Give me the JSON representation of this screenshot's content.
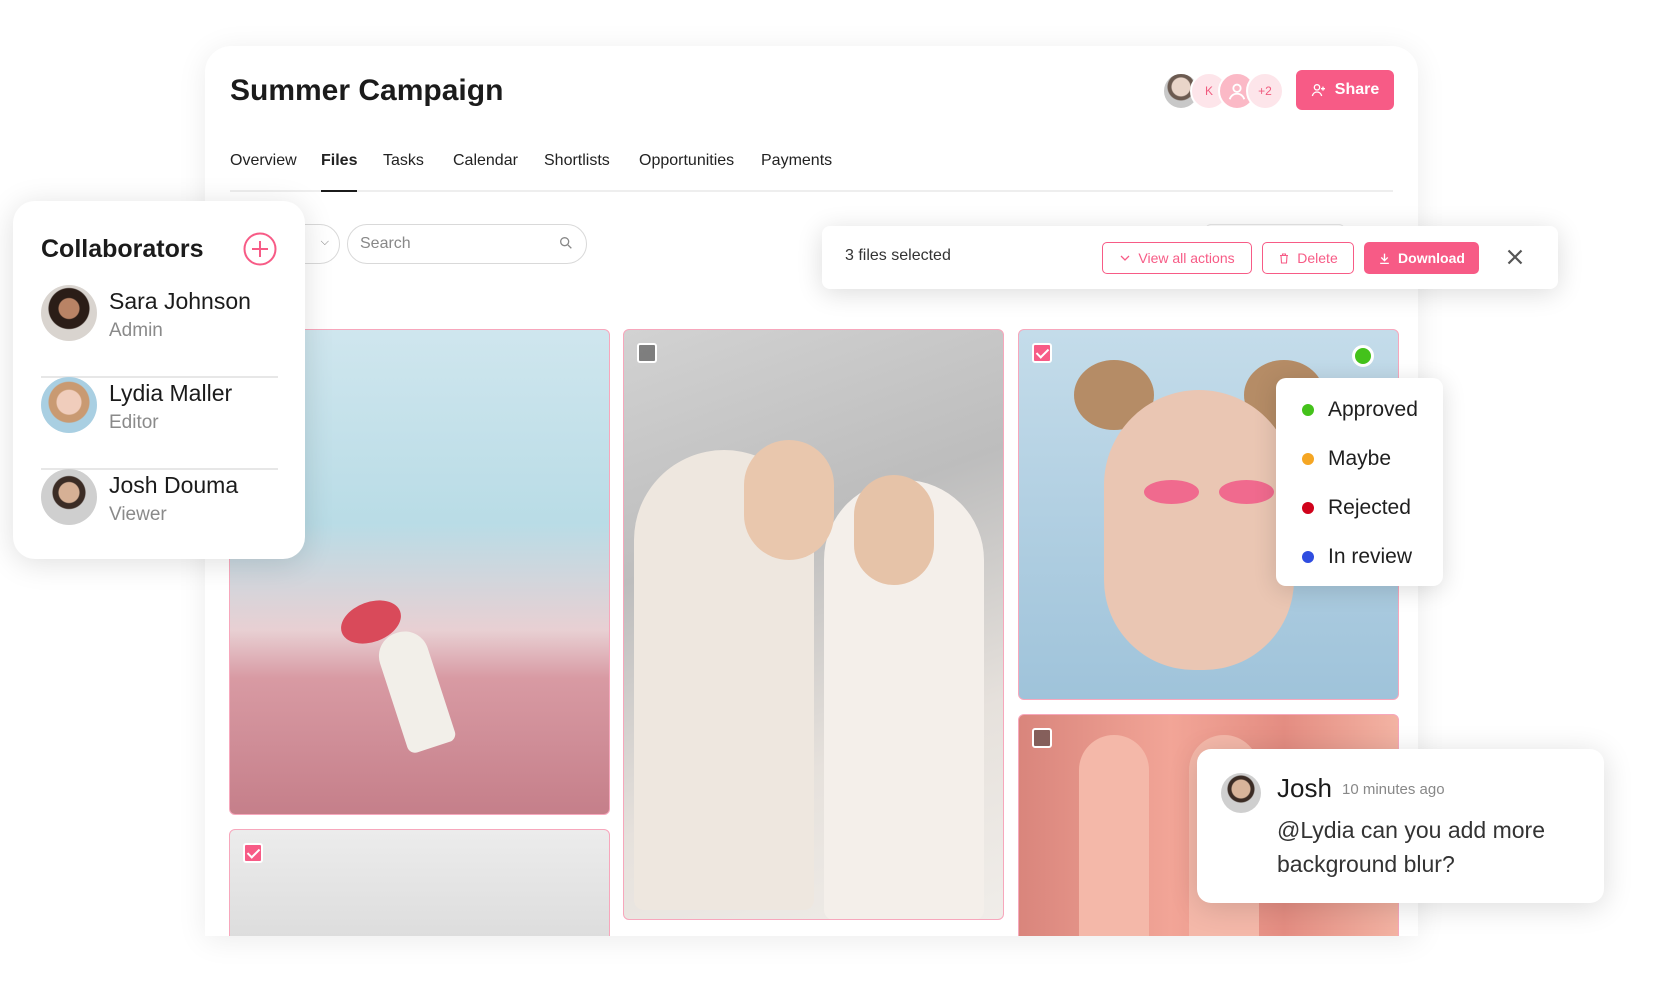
{
  "project": {
    "title": "Summer Campaign"
  },
  "header": {
    "avatars": [
      {
        "name": "member-avatar-photo",
        "initial": ""
      },
      {
        "name": "member-avatar-k",
        "initial": "K"
      },
      {
        "name": "member-avatar-generic",
        "initial": ""
      },
      {
        "name": "member-avatar-more",
        "initial": "+2"
      }
    ],
    "share_label": "Share",
    "accent": "#f75b86"
  },
  "tabs": [
    "Overview",
    "Files",
    "Tasks",
    "Calendar",
    "Shortlists",
    "Opportunities",
    "Payments"
  ],
  "active_tab": "Files",
  "search": {
    "placeholder": "Search"
  },
  "selection": {
    "count_label": "3 files selected",
    "view_all_label": "View all actions",
    "delete_label": "Delete",
    "download_label": "Download"
  },
  "statuses": [
    {
      "label": "Approved",
      "color": "#44c21b"
    },
    {
      "label": "Maybe",
      "color": "#f5a623"
    },
    {
      "label": "Rejected",
      "color": "#d0021b"
    },
    {
      "label": "In review",
      "color": "#2f4de0"
    }
  ],
  "collaborators": {
    "title": "Collaborators",
    "people": [
      {
        "name": "Sara Johnson",
        "role": "Admin"
      },
      {
        "name": "Lydia Maller",
        "role": "Editor"
      },
      {
        "name": "Josh Douma",
        "role": "Viewer"
      }
    ]
  },
  "comment": {
    "author": "Josh",
    "time": "10 minutes ago",
    "text": "@Lydia can you add more background blur?"
  },
  "files": [
    {
      "name": "flower-field-photo",
      "selected": false
    },
    {
      "name": "grey-sky-photo",
      "selected": true
    },
    {
      "name": "two-women-photo",
      "selected": false
    },
    {
      "name": "pink-makeup-portrait-photo",
      "selected": true,
      "status": "Approved"
    },
    {
      "name": "pink-arches-photo",
      "selected": false
    }
  ]
}
